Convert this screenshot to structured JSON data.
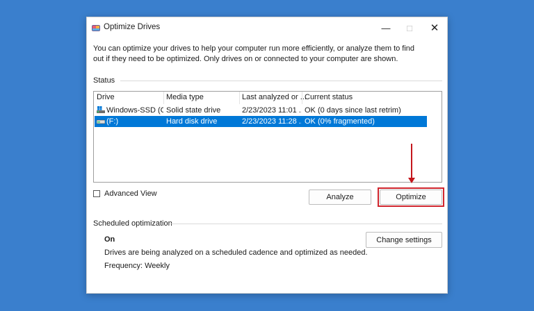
{
  "window": {
    "title": "Optimize Drives",
    "minimize_icon": "minimize-icon",
    "maximize_icon": "maximize-icon",
    "close_icon": "close-icon"
  },
  "description": "You can optimize your drives to help your computer run more efficiently, or analyze them to find out if they need to be optimized. Only drives on or connected to your computer are shown.",
  "status": {
    "label": "Status",
    "columns": [
      "Drive",
      "Media type",
      "Last analyzed or ...",
      "Current status"
    ],
    "rows": [
      {
        "drive": "Windows-SSD (C:)",
        "media": "Solid state drive",
        "last": "2/23/2023 11:01 ...",
        "status": "OK (0 days since last retrim)",
        "selected": false
      },
      {
        "drive": "(F:)",
        "media": "Hard disk drive",
        "last": "2/23/2023 11:28 ...",
        "status": "OK (0% fragmented)",
        "selected": true
      }
    ],
    "selected_color": "#0078d7"
  },
  "advanced_view": {
    "label": "Advanced View",
    "checked": false
  },
  "buttons": {
    "analyze": "Analyze",
    "optimize": "Optimize",
    "change_settings": "Change settings"
  },
  "scheduled": {
    "label": "Scheduled optimization",
    "state": "On",
    "description": "Drives are being analyzed on a scheduled cadence and optimized as needed.",
    "frequency": "Frequency: Weekly"
  },
  "annotation": {
    "color": "#d0252d"
  }
}
